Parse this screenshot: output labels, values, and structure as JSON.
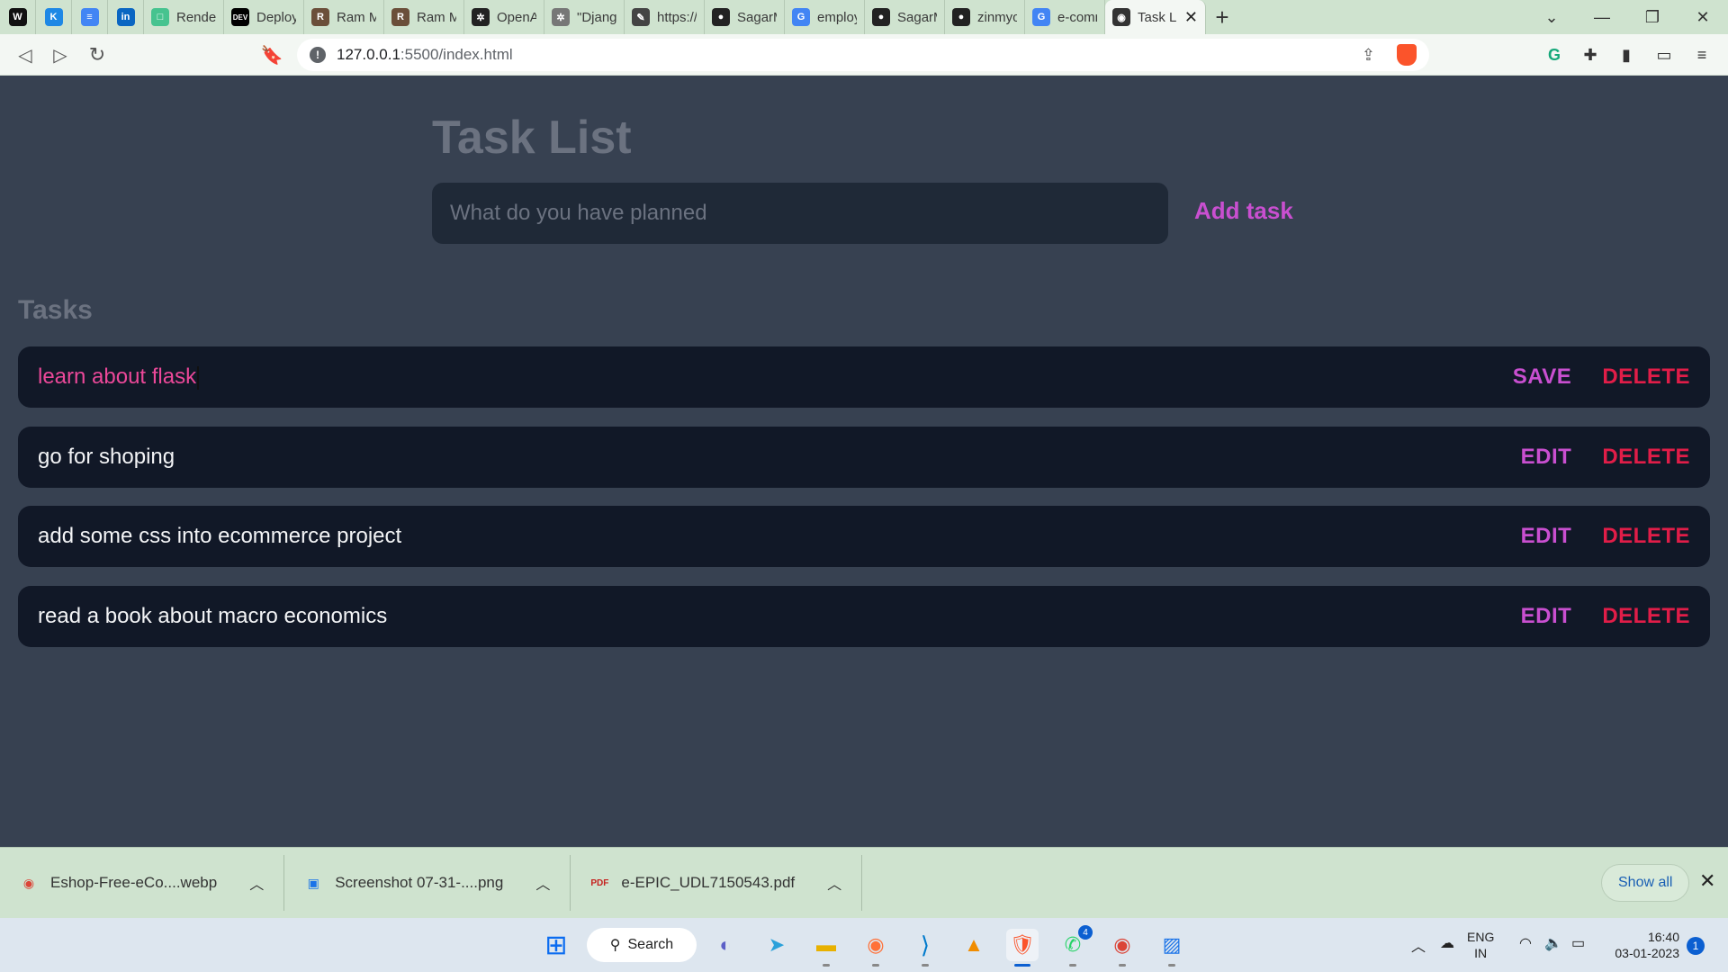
{
  "browser": {
    "tabs": [
      {
        "title": "",
        "icon": "wordle-icon",
        "favicon_text": "W",
        "color": "#111111",
        "pinned": true
      },
      {
        "title": "",
        "icon": "kaggle-icon",
        "favicon_text": "K",
        "color": "#1e88e5",
        "pinned": true
      },
      {
        "title": "",
        "icon": "docs-icon",
        "favicon_text": "≡",
        "color": "#4285f4",
        "pinned": true
      },
      {
        "title": "",
        "icon": "linkedin-icon",
        "favicon_text": "in",
        "color": "#0a66c2",
        "pinned": true
      },
      {
        "title": "Render D",
        "icon": "render-icon",
        "favicon_text": "□",
        "color": "#46c38f"
      },
      {
        "title": "Deployin",
        "icon": "dev-icon",
        "favicon_text": "DEV",
        "color": "#000000"
      },
      {
        "title": "Ram Mal",
        "icon": "profile-icon",
        "favicon_text": "R",
        "color": "#6b4f3a"
      },
      {
        "title": "Ram Mah",
        "icon": "profile-icon",
        "favicon_text": "R",
        "color": "#6b4f3a"
      },
      {
        "title": "OpenAI",
        "icon": "openai-icon",
        "favicon_text": "✲",
        "color": "#222222"
      },
      {
        "title": "\"Django c",
        "icon": "openai-icon",
        "favicon_text": "✲",
        "color": "#777777"
      },
      {
        "title": "https://w",
        "icon": "link-icon",
        "favicon_text": "✎",
        "color": "#444444"
      },
      {
        "title": "SagarMa",
        "icon": "github-icon",
        "favicon_text": "●",
        "color": "#222222"
      },
      {
        "title": "employe",
        "icon": "google-icon",
        "favicon_text": "G",
        "color": "#4285f4"
      },
      {
        "title": "SagarMal",
        "icon": "github-icon",
        "favicon_text": "●",
        "color": "#222222"
      },
      {
        "title": "zinmyosw",
        "icon": "github-icon",
        "favicon_text": "●",
        "color": "#222222"
      },
      {
        "title": "e-comme",
        "icon": "google-icon",
        "favicon_text": "G",
        "color": "#4285f4"
      },
      {
        "title": "Task L",
        "icon": "globe-icon",
        "favicon_text": "◉",
        "color": "#333333",
        "active": true
      }
    ],
    "url_host": "127.0.0.1",
    "url_rest": ":5500/index.html"
  },
  "page": {
    "title": "Task List",
    "input_placeholder": "What do you have planned",
    "add_label": "Add task",
    "tasks_heading": "Tasks"
  },
  "tasks": [
    {
      "text": "learn about flask",
      "action": "SAVE",
      "delete": "DELETE",
      "editing": true
    },
    {
      "text": "go for shoping",
      "action": "EDIT",
      "delete": "DELETE",
      "editing": false
    },
    {
      "text": "add some css into ecommerce project",
      "action": "EDIT",
      "delete": "DELETE",
      "editing": false
    },
    {
      "text": "read a book about macro economics",
      "action": "EDIT",
      "delete": "DELETE",
      "editing": false
    }
  ],
  "downloads": [
    {
      "name": "Eshop-Free-eCo....webp",
      "icon": "chrome-icon"
    },
    {
      "name": "Screenshot 07-31-....png",
      "icon": "image-file-icon"
    },
    {
      "name": "e-EPIC_UDL7150543.pdf",
      "icon": "pdf-icon"
    }
  ],
  "show_all": "Show all",
  "taskbar": {
    "search_label": "Search",
    "whatsapp_badge": "4",
    "lang_line1": "ENG",
    "lang_line2": "IN",
    "time": "16:40",
    "date": "03-01-2023",
    "notifications": "1"
  }
}
